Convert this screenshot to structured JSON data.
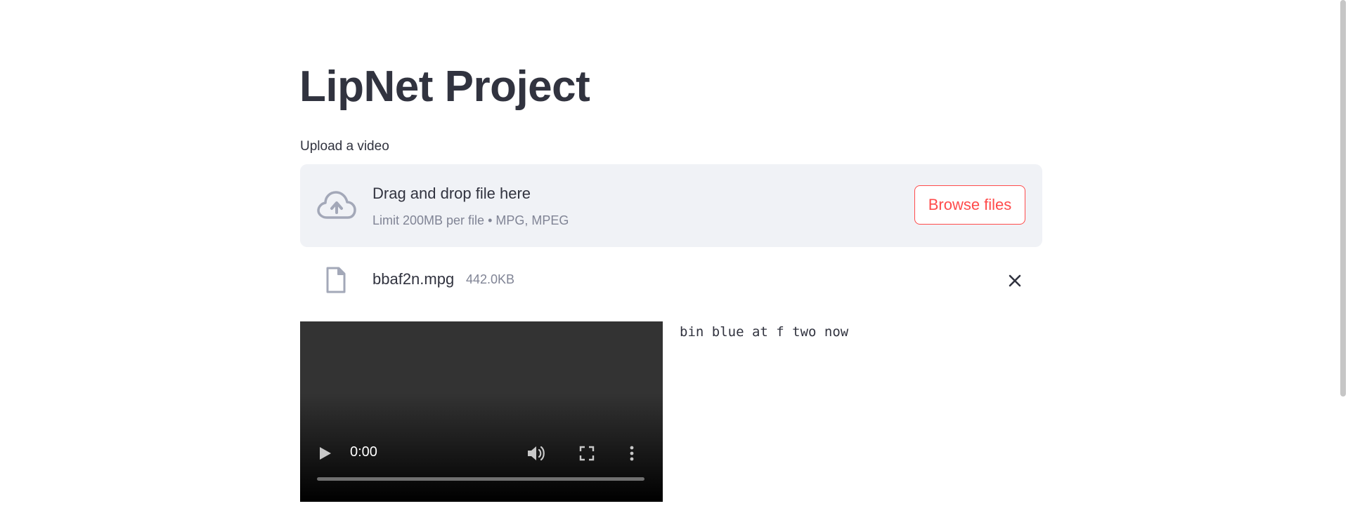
{
  "app": {
    "title": "LipNet Project"
  },
  "uploader": {
    "label": "Upload a video",
    "drop_title": "Drag and drop file here",
    "drop_subtitle": "Limit 200MB per file • MPG, MPEG",
    "browse_label": "Browse files",
    "icon": "cloud-upload-icon"
  },
  "uploaded_file": {
    "name": "bbaf2n.mpg",
    "size": "442.0KB",
    "icon": "file-icon",
    "remove_icon": "close-icon"
  },
  "video_player": {
    "time": "0:00",
    "progress": 0,
    "controls": [
      "play-icon",
      "volume-icon",
      "fullscreen-icon",
      "more-options-icon"
    ]
  },
  "prediction": {
    "text": "bin blue at f two now"
  },
  "colors": {
    "primary": "#ff4b4b",
    "text": "#31333f",
    "muted": "#808495",
    "dropzone_bg": "#f0f2f6",
    "icon": "#a3a8b8"
  }
}
